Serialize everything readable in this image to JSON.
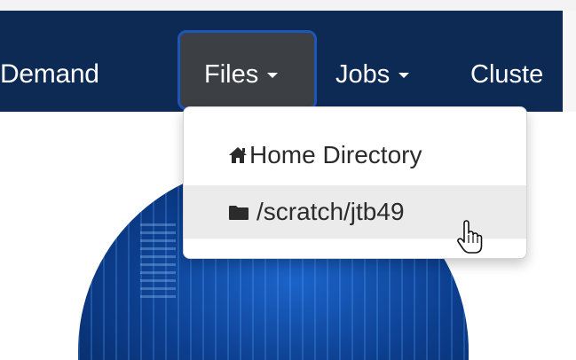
{
  "navbar": {
    "brand": "Demand",
    "items": [
      {
        "label": "Files"
      },
      {
        "label": "Jobs"
      },
      {
        "label": "Cluste"
      }
    ]
  },
  "dropdown": {
    "items": [
      {
        "label": "Home Directory",
        "icon": "home-icon"
      },
      {
        "label": "/scratch/jtb49",
        "icon": "folder-icon"
      }
    ]
  },
  "colors": {
    "navbar_bg": "#0d2a55",
    "active_tab_bg": "#3c3f44",
    "focus_ring": "#1d56b8",
    "dropdown_hover_bg": "#ebebeb"
  }
}
